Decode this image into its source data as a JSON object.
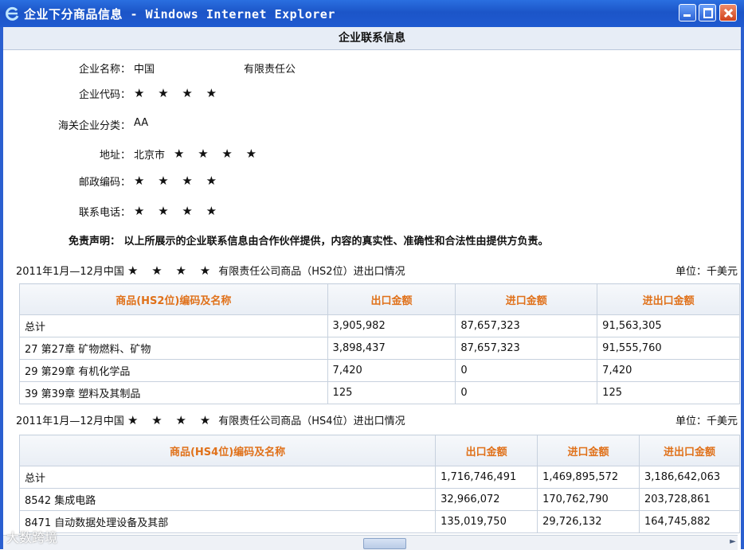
{
  "window": {
    "title": "企业下分商品信息 - Windows Internet Explorer",
    "icon": "ie-icon"
  },
  "section_title": "企业联系信息",
  "company": {
    "name_label": "企业名称：",
    "name_value": "中国",
    "name_suffix": "有限责任公",
    "code_label": "企业代码：",
    "code_value": "★ ★ ★ ★",
    "customs_label": "海关企业分类：",
    "customs_value": "AA",
    "address_label": "地址：",
    "address_city": "北京市",
    "address_value": "★ ★ ★ ★",
    "postcode_label": "邮政编码：",
    "postcode_value": "★ ★ ★ ★",
    "phone_label": "联系电话：",
    "phone_value": "★ ★ ★ ★"
  },
  "disclaimer": {
    "label": "免责声明：",
    "text": "以上所展示的企业联系信息由合作伙伴提供，内容的真实性、准确性和合法性由提供方负责。"
  },
  "hs2": {
    "title_prefix": "2011年1月—12月中国",
    "title_stars": "★ ★ ★ ★",
    "title_suffix": "有限责任公司商品（HS2位）进出口情况",
    "unit": "单位：千美元",
    "headers": [
      "商品(HS2位)编码及名称",
      "出口金额",
      "进口金额",
      "进出口金额"
    ],
    "rows": [
      [
        "总计",
        "3,905,982",
        "87,657,323",
        "91,563,305"
      ],
      [
        "27 第27章 矿物燃料、矿物",
        "3,898,437",
        "87,657,323",
        "91,555,760"
      ],
      [
        "29 第29章 有机化学品",
        "7,420",
        "0",
        "7,420"
      ],
      [
        "39 第39章 塑料及其制品",
        "125",
        "0",
        "125"
      ]
    ]
  },
  "hs4": {
    "title_prefix": "2011年1月—12月中国",
    "title_stars": "★ ★ ★ ★",
    "title_suffix": "有限责任公司商品（HS4位）进出口情况",
    "unit": "单位：千美元",
    "headers": [
      "商品(HS4位)编码及名称",
      "出口金额",
      "进口金额",
      "进出口金额"
    ],
    "rows": [
      [
        "总计",
        "1,716,746,491",
        "1,469,895,572",
        "3,186,642,063"
      ],
      [
        "8542 集成电路",
        "32,966,072",
        "170,762,790",
        "203,728,861"
      ],
      [
        "8471 自动数据处理设备及其部",
        "135,019,750",
        "29,726,132",
        "164,745,882"
      ]
    ]
  },
  "watermark": "大数跨境"
}
